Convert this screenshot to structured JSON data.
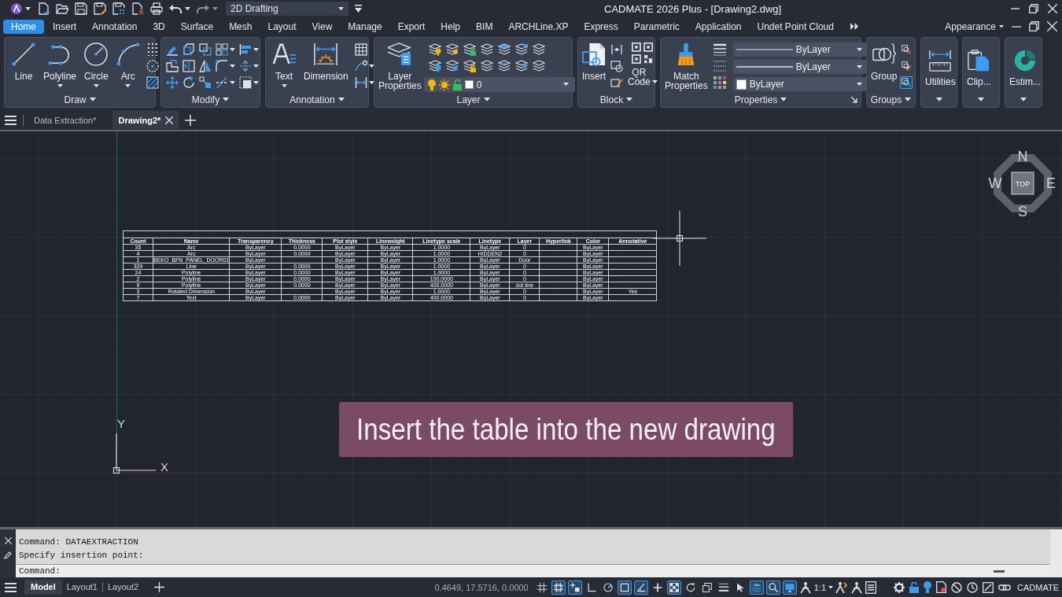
{
  "quick_access": {
    "workspace": "2D Drafting"
  },
  "window": {
    "title": "CADMATE 2026 Plus - [Drawing2.dwg]"
  },
  "ribbon_tabs": [
    {
      "label": "Home",
      "selected": true
    },
    {
      "label": "Insert",
      "selected": false
    },
    {
      "label": "Annotation",
      "selected": false
    },
    {
      "label": "3D",
      "selected": false
    },
    {
      "label": "Surface",
      "selected": false
    },
    {
      "label": "Mesh",
      "selected": false
    },
    {
      "label": "Layout",
      "selected": false
    },
    {
      "label": "View",
      "selected": false
    },
    {
      "label": "Manage",
      "selected": false
    },
    {
      "label": "Export",
      "selected": false
    },
    {
      "label": "Help",
      "selected": false
    },
    {
      "label": "BIM",
      "selected": false
    },
    {
      "label": "ARCHLine.XP",
      "selected": false
    },
    {
      "label": "Express",
      "selected": false
    },
    {
      "label": "Parametric",
      "selected": false
    },
    {
      "label": "Application",
      "selected": false
    },
    {
      "label": "Undet Point Cloud",
      "selected": false
    }
  ],
  "appearance_menu": {
    "label": "Appearance"
  },
  "ribbon_panels": [
    {
      "kind": "draw",
      "title": "Draw",
      "tools": [
        {
          "label": "Line",
          "dropdown": false
        },
        {
          "label": "Polyline",
          "dropdown": true
        },
        {
          "label": "Circle",
          "dropdown": true
        },
        {
          "label": "Arc",
          "dropdown": true
        }
      ]
    },
    {
      "kind": "modify",
      "title": "Modify"
    },
    {
      "kind": "annotation",
      "title": "Annotation",
      "tools": [
        {
          "label": "Text",
          "dropdown": true
        },
        {
          "label": "Dimension",
          "dropdown": false
        }
      ]
    },
    {
      "kind": "layer",
      "title": "Layer",
      "tools": [
        {
          "label": "Layer Properties",
          "dropdown": false
        }
      ],
      "layer_dropdown": {
        "value": "0"
      }
    },
    {
      "kind": "block",
      "title": "Block",
      "tools": [
        {
          "label": "Insert",
          "dropdown": false
        },
        {
          "label": "QR Code",
          "dropdown": true
        }
      ]
    },
    {
      "kind": "properties",
      "title": "Properties",
      "tools": [
        {
          "label": "Match Properties",
          "dropdown": false
        }
      ],
      "dropdowns": [
        {
          "kind": "linetype",
          "value": "ByLayer"
        },
        {
          "kind": "lineweight",
          "value": "ByLayer"
        },
        {
          "kind": "color",
          "value": "ByLayer"
        }
      ]
    },
    {
      "kind": "groups",
      "title": "Groups",
      "tools": [
        {
          "label": "Group",
          "dropdown": false
        }
      ],
      "toggles": [
        {
          "on": false
        },
        {
          "on": false
        },
        {
          "on": true
        }
      ]
    },
    {
      "kind": "utilities",
      "tools": [
        {
          "label": "Utilities",
          "dropdown": true
        }
      ]
    },
    {
      "kind": "clipboard",
      "tools": [
        {
          "label": "Clip...",
          "dropdown": true
        }
      ]
    },
    {
      "kind": "estimating",
      "tools": [
        {
          "label": "Estim...",
          "dropdown": true
        }
      ]
    }
  ],
  "document_tabs": [
    {
      "label": "Data Extraction*",
      "selected": false
    },
    {
      "label": "Drawing2*",
      "selected": true
    }
  ],
  "drawing": {
    "table": {
      "columns": [
        "Count",
        "Name",
        "Transparency",
        "Thickness",
        "Plot style",
        "Lineweight",
        "Linetype scale",
        "Linetype",
        "Layer",
        "Hyperlink",
        "Color",
        "Annotative"
      ],
      "rows": [
        {
          "count": "35",
          "name": "Arc",
          "transparency": "ByLayer",
          "thickness": "0.0000",
          "plot_style": "ByLayer",
          "lineweight": "ByLayer",
          "linetype_scale": "1.0000",
          "linetype": "ByLayer",
          "layer": "0",
          "color_setting": "ByLayer"
        },
        {
          "count": "4",
          "name": "Arc",
          "transparency": "ByLayer",
          "thickness": "0.0000",
          "plot_style": "ByLayer",
          "lineweight": "ByLayer",
          "linetype_scale": "1.0000",
          "linetype": "HIDDEN2",
          "layer": "0",
          "color_setting": "ByLayer"
        },
        {
          "count": "1",
          "name": "BEKO_BFN_PANEL_DOOR01",
          "transparency": "ByLayer",
          "plot_style": "ByLayer",
          "lineweight": "ByLayer",
          "linetype_scale": "1.0000",
          "linetype": "ByLayer",
          "layer": "Door",
          "color_setting": "ByLayer"
        },
        {
          "count": "339",
          "name": "Line",
          "transparency": "ByLayer",
          "thickness": "0.0000",
          "plot_style": "ByLayer",
          "lineweight": "ByLayer",
          "linetype_scale": "1.0000",
          "linetype": "ByLayer",
          "layer": "0",
          "color_setting": "ByLayer"
        },
        {
          "count": "24",
          "name": "Polyline",
          "transparency": "ByLayer",
          "thickness": "0.0000",
          "plot_style": "ByLayer",
          "lineweight": "ByLayer",
          "linetype_scale": "1.0000",
          "linetype": "ByLayer",
          "layer": "0",
          "color_setting": "ByLayer"
        },
        {
          "count": "2",
          "name": "Polyline",
          "transparency": "ByLayer",
          "thickness": "0.0000",
          "plot_style": "ByLayer",
          "lineweight": "ByLayer",
          "linetype_scale": "100.0000",
          "linetype": "ByLayer",
          "layer": "0",
          "color_setting": "ByLayer"
        },
        {
          "count": "9",
          "name": "Polyline",
          "transparency": "ByLayer",
          "thickness": "0.0000",
          "plot_style": "ByLayer",
          "lineweight": "ByLayer",
          "linetype_scale": "400.0000",
          "linetype": "ByLayer",
          "layer": "dot line",
          "color_setting": "ByLayer"
        },
        {
          "count": "3",
          "name": "Rotated Dimension",
          "transparency": "ByLayer",
          "plot_style": "ByLayer",
          "lineweight": "ByLayer",
          "linetype_scale": "1.0000",
          "linetype": "ByLayer",
          "layer": "0",
          "color_setting": "ByLayer",
          "annotative": "Yes"
        },
        {
          "count": "7",
          "name": "Text",
          "transparency": "ByLayer",
          "thickness": "0.0000",
          "plot_style": "ByLayer",
          "lineweight": "ByLayer",
          "linetype_scale": "400.0000",
          "linetype": "ByLayer",
          "layer": "0",
          "color_setting": "ByLayer"
        }
      ]
    },
    "view_cube": {
      "face": "TOP",
      "north": "N",
      "west": "W",
      "east": "E",
      "south": "S"
    },
    "ucs": {
      "x_label": "X",
      "y_label": "Y"
    },
    "caption": "Insert the table into the new drawing"
  },
  "command_line": {
    "history": [
      "Command: DATAEXTRACTION",
      "Specify insertion point:"
    ],
    "prompt": "Command:"
  },
  "status_bar": {
    "layout_tabs": [
      {
        "label": "Model",
        "selected": true
      },
      {
        "label": "Layout1",
        "selected": false
      },
      {
        "label": "Layout2",
        "selected": false
      }
    ],
    "coordinates": "0.4649, 17.5716, 0.0000",
    "toggles": [
      {
        "kind": "grid",
        "on": false
      },
      {
        "kind": "snap",
        "on": true
      },
      {
        "kind": "infer",
        "on": true
      },
      {
        "kind": "ortho",
        "on": false
      },
      {
        "kind": "polar",
        "on": false
      },
      {
        "kind": "osnap",
        "on": true
      },
      {
        "kind": "otrack",
        "on": true
      },
      {
        "kind": "dynamic_input",
        "on": false
      },
      {
        "kind": "transparency",
        "on": true
      },
      {
        "kind": "cycling",
        "on": false
      },
      {
        "kind": "snap_3d",
        "on": false
      },
      {
        "kind": "lineweight",
        "on": false
      },
      {
        "kind": "selection",
        "on": false
      },
      {
        "kind": "layers",
        "on": true
      },
      {
        "kind": "zoom",
        "on": true
      },
      {
        "kind": "display",
        "on": true
      }
    ],
    "annotation_scale": "1:1",
    "workspace_label": "CADMATE"
  }
}
